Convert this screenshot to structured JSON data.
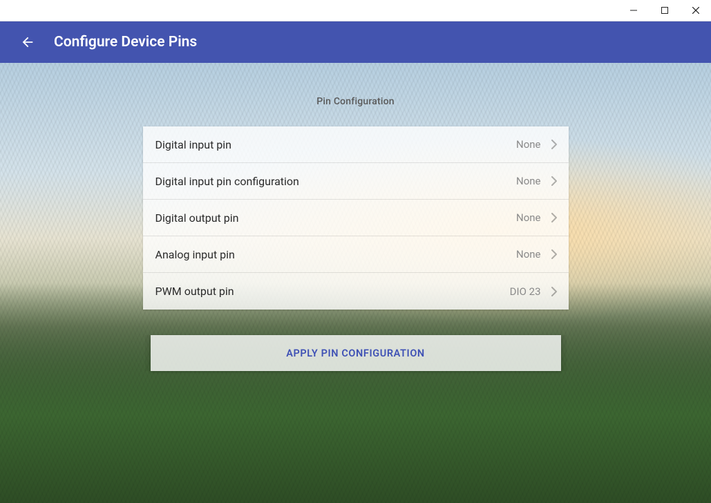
{
  "window": {
    "minimize_icon": "minimize-icon",
    "maximize_icon": "maximize-icon",
    "close_icon": "close-icon"
  },
  "header": {
    "back_icon": "arrow-left-icon",
    "title": "Configure Device Pins"
  },
  "main": {
    "section_title": "Pin Configuration",
    "rows": [
      {
        "label": "Digital input pin",
        "value": "None"
      },
      {
        "label": "Digital input pin configuration",
        "value": "None"
      },
      {
        "label": "Digital output pin",
        "value": "None"
      },
      {
        "label": "Analog input pin",
        "value": "None"
      },
      {
        "label": "PWM output pin",
        "value": "DIO 23"
      }
    ],
    "apply_button_label": "APPLY PIN CONFIGURATION"
  }
}
